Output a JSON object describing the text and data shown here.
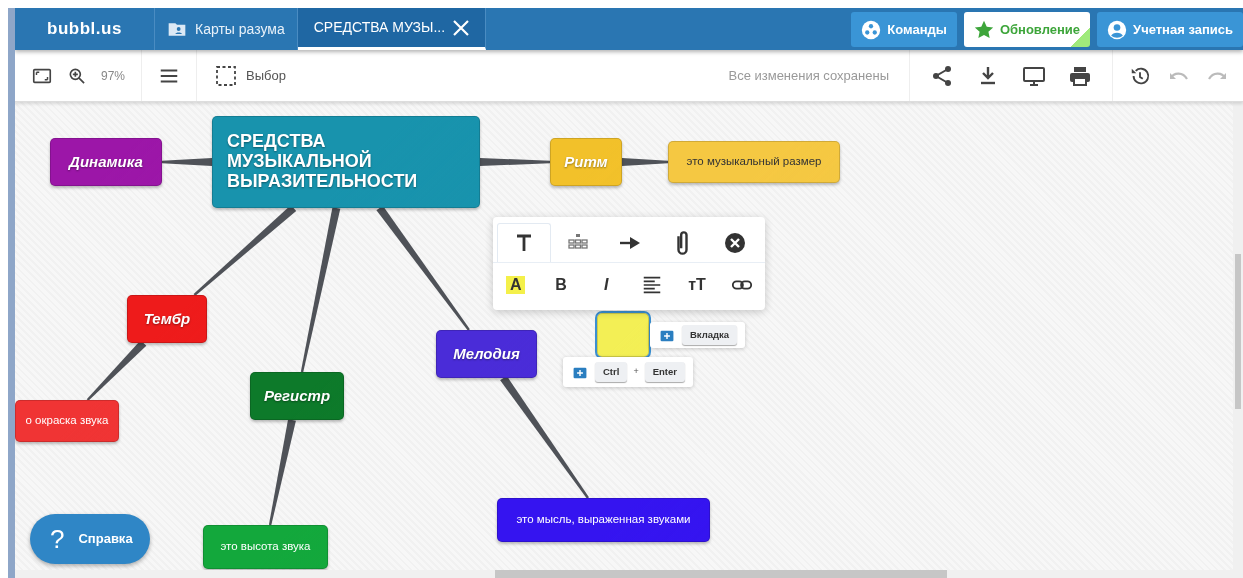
{
  "topbar": {
    "logo": "bubbl.us",
    "tabs": [
      {
        "label": "Карты разума",
        "selected": false,
        "closable": false
      },
      {
        "label": "СРЕДСТВА МУЗЫ...",
        "selected": true,
        "closable": true
      }
    ],
    "buttons": [
      {
        "label": "Команды",
        "kind": "teams"
      },
      {
        "label": "Обновление",
        "kind": "upgrade"
      },
      {
        "label": "Учетная запись",
        "kind": "account"
      }
    ]
  },
  "toolbar": {
    "zoom": "97%",
    "select": "Выбор",
    "status": "Все изменения сохранены",
    "undo_disabled": true,
    "redo_disabled": true
  },
  "map": {
    "root": {
      "text": "СРЕДСТВА МУЗЫКАЛЬНОЙ ВЫРАЗИТЕЛЬНОСТИ",
      "kind": "root",
      "color": "#1893ad",
      "selected": false,
      "children": [
        {
          "text": "Динамика",
          "kind": "topic",
          "color": "#9c16a8",
          "selected": false
        },
        {
          "text": "Ритм",
          "kind": "topic",
          "color": "#f2c12a",
          "selected": false,
          "children": [
            {
              "text": "это музыкальный размер",
              "kind": "note",
              "color": "#f5c842",
              "selected": false
            }
          ]
        },
        {
          "text": "Тембр",
          "kind": "topic",
          "color": "#ee1b1b",
          "selected": false,
          "children": [
            {
              "text": "о окраска звука",
              "kind": "note",
              "color": "#f03434",
              "selected": false
            }
          ]
        },
        {
          "text": "Регистр",
          "kind": "topic",
          "color": "#0d7a2a",
          "selected": false,
          "children": [
            {
              "text": "это высота звука",
              "kind": "note",
              "color": "#13a83c",
              "selected": false
            }
          ]
        },
        {
          "text": "Мелодия",
          "kind": "topic",
          "color": "#4a2cd8",
          "selected": false,
          "children": [
            {
              "text": "это мысль, выраженная звуками",
              "kind": "note",
              "color": "#3514f0",
              "selected": false
            }
          ]
        }
      ]
    },
    "new_node": {
      "kind": "sticky",
      "color": "#f3ef55",
      "selected": true
    }
  },
  "format_popup": {
    "tabs": [
      {
        "kind": "text",
        "selected": true
      },
      {
        "kind": "layout",
        "selected": false
      },
      {
        "kind": "arrow",
        "selected": false
      },
      {
        "kind": "attach",
        "selected": false
      },
      {
        "kind": "delete",
        "selected": false
      }
    ],
    "buttons": [
      {
        "kind": "highlight",
        "label": "A"
      },
      {
        "kind": "bold",
        "label": "B"
      },
      {
        "kind": "italic",
        "label": "I"
      },
      {
        "kind": "align"
      },
      {
        "kind": "size",
        "label": "тT"
      },
      {
        "kind": "link"
      }
    ]
  },
  "hints": [
    {
      "keys": [
        "Вкладка"
      ]
    },
    {
      "keys": [
        "Ctrl",
        "+",
        "Enter"
      ]
    }
  ],
  "help": {
    "icon": "?",
    "label": "Справка"
  }
}
